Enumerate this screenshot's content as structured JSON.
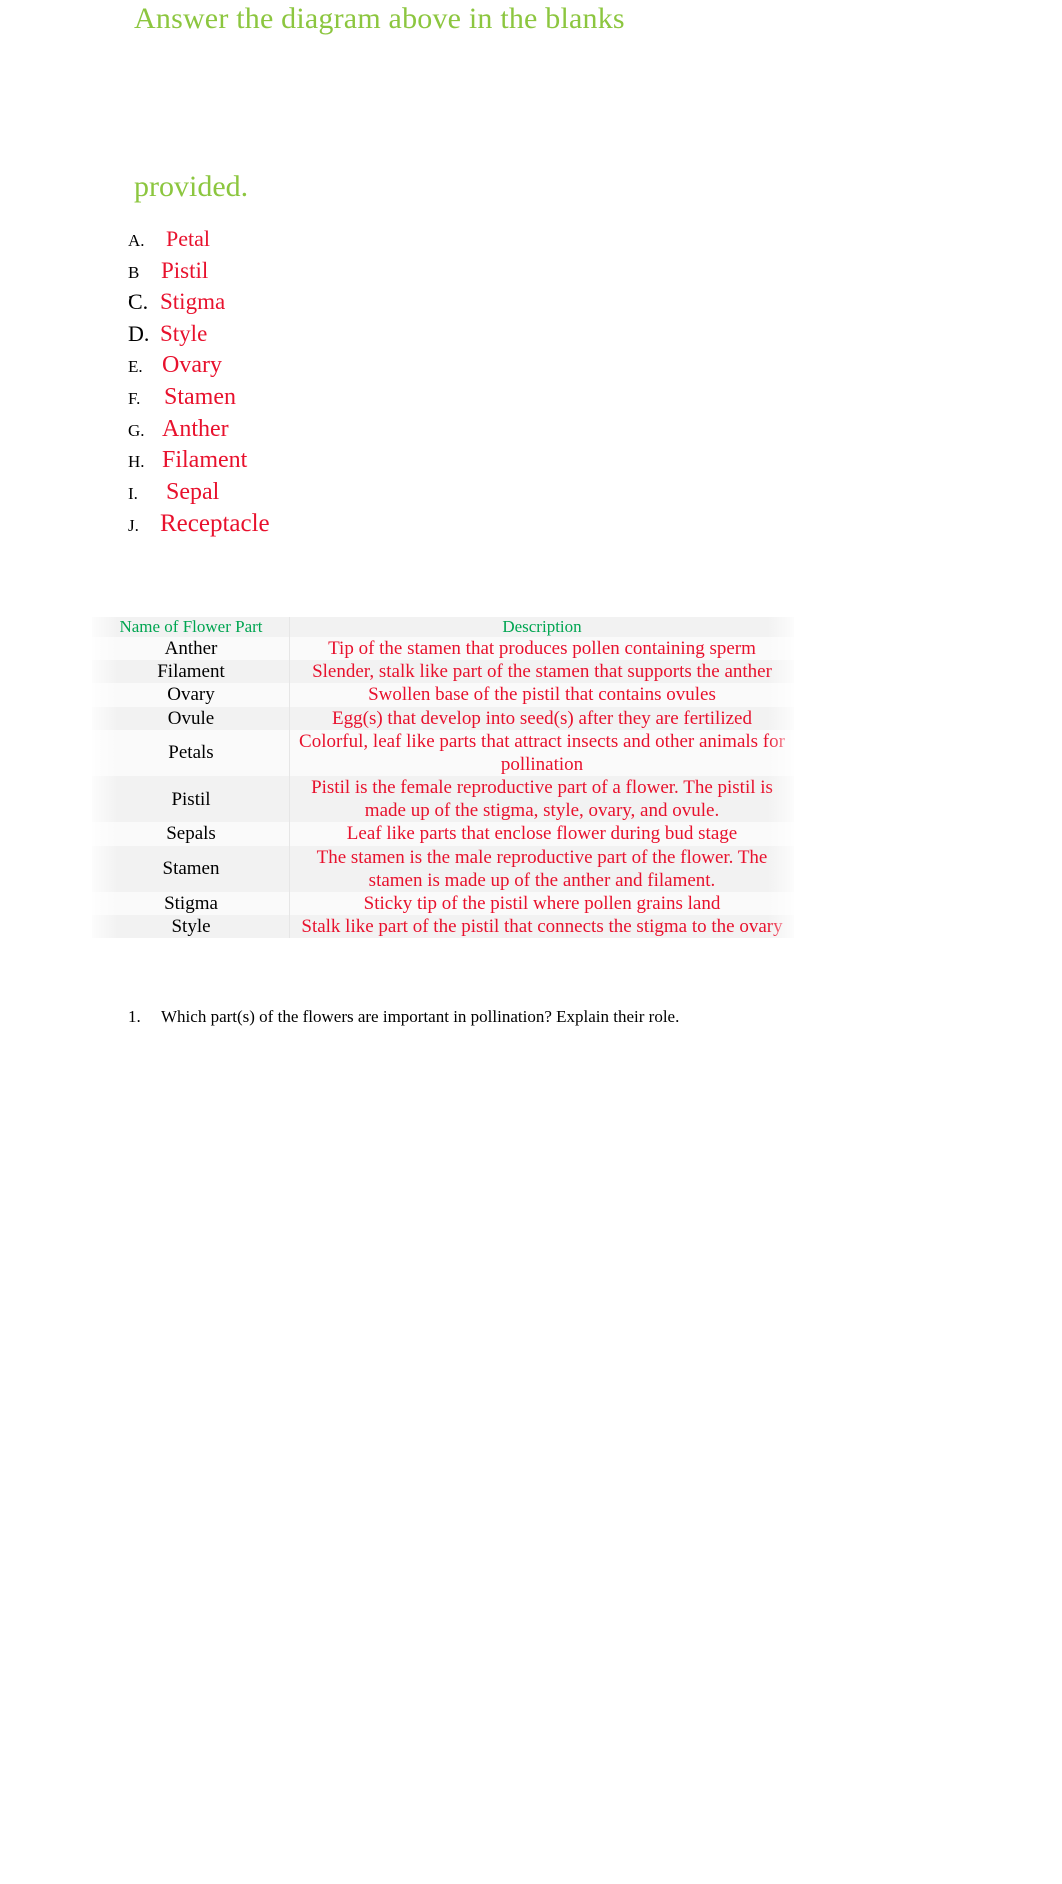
{
  "heading": {
    "line1": "Answer the diagram above in the blanks",
    "line2": "provided.",
    "color": "#8CC63F"
  },
  "answer_list": {
    "items": [
      {
        "letter": "A.",
        "term": "Petal"
      },
      {
        "letter": "B .",
        "term": "Pistil"
      },
      {
        "letter": "C.",
        "term": "Stigma"
      },
      {
        "letter": "D.",
        "term": "Style"
      },
      {
        "letter": "E.",
        "term": "Ovary"
      },
      {
        "letter": "F.",
        "term": "Stamen"
      },
      {
        "letter": "G.",
        "term": "Anther"
      },
      {
        "letter": "H.",
        "term": "Filament"
      },
      {
        "letter": "I.",
        "term": "Sepal"
      },
      {
        "letter": "J.",
        "term": "Receptacle"
      }
    ],
    "letter_color": "#000000",
    "term_color": "#E8112D"
  },
  "table": {
    "headers": {
      "name": "Name of Flower Part",
      "description": "Description"
    },
    "header_color": "#00A551",
    "name_color": "#000000",
    "description_color": "#E8112D",
    "rows": [
      {
        "name": "Anther",
        "description": "Tip of the stamen that produces pollen containing sperm"
      },
      {
        "name": "Filament",
        "description": "Slender, stalk like part of the stamen that supports the anther"
      },
      {
        "name": "Ovary",
        "description": "Swollen base of the pistil that contains ovules"
      },
      {
        "name": "Ovule",
        "description": "Egg(s) that develop into seed(s) after they are fertilized"
      },
      {
        "name": "Petals",
        "description": "Colorful, leaf like parts that attract insects and other animals for pollination"
      },
      {
        "name": "Pistil",
        "description": "Pistil is the female reproductive part of a flower. The pistil is made up of the stigma, style, ovary, and ovule."
      },
      {
        "name": "Sepals",
        "description": "Leaf like parts that enclose flower during bud stage"
      },
      {
        "name": "Stamen",
        "description": "The stamen is the male reproductive part of the flower. The stamen is made up of the anther and filament."
      },
      {
        "name": "Stigma",
        "description": "Sticky tip of the pistil where pollen grains land"
      },
      {
        "name": "Style",
        "description": "Stalk like part of the pistil that connects the stigma to the ovary"
      }
    ]
  },
  "question": {
    "number": "1.",
    "text": "Which part(s) of the flowers are important in pollination? Explain their role."
  }
}
